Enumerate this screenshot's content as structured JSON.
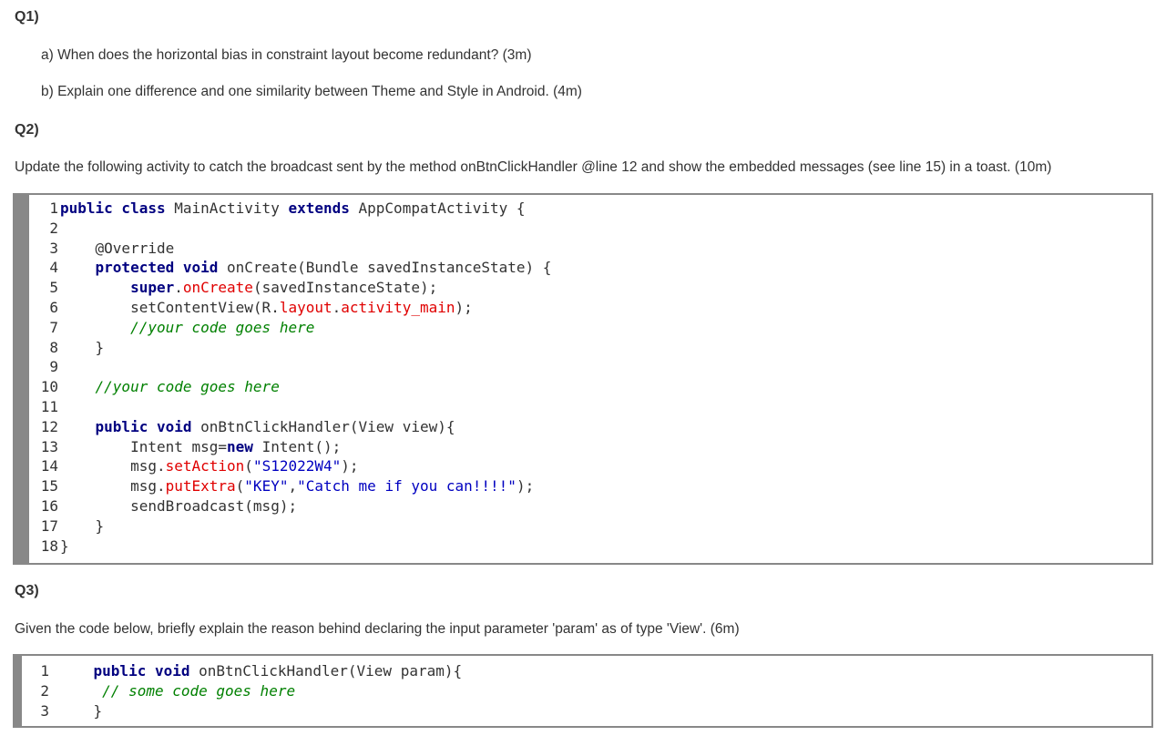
{
  "q1": {
    "heading": "Q1)",
    "a": "a) When does the horizontal bias in constraint layout become redundant? (3m)",
    "b": "b) Explain one difference and one similarity between Theme and Style in Android. (4m)"
  },
  "q2": {
    "heading": "Q2)",
    "prompt": "Update the following activity to catch the broadcast sent by the method onBtnClickHandler @line 12 and show the embedded messages (see line 15) in a toast. (10m)",
    "code": [
      {
        "n": "1",
        "indent": "",
        "tokens": [
          {
            "t": "public class",
            "c": "kw"
          },
          {
            "t": " MainActivity ",
            "c": "plain"
          },
          {
            "t": "extends",
            "c": "kw"
          },
          {
            "t": " AppCompatActivity {",
            "c": "plain"
          }
        ]
      },
      {
        "n": "2",
        "indent": "",
        "tokens": []
      },
      {
        "n": "3",
        "indent": "    ",
        "tokens": [
          {
            "t": "@Override",
            "c": "plain"
          }
        ]
      },
      {
        "n": "4",
        "indent": "    ",
        "tokens": [
          {
            "t": "protected void",
            "c": "kw"
          },
          {
            "t": " onCreate(Bundle savedInstanceState) {",
            "c": "plain"
          }
        ]
      },
      {
        "n": "5",
        "indent": "        ",
        "tokens": [
          {
            "t": "super",
            "c": "kw"
          },
          {
            "t": ".",
            "c": "plain"
          },
          {
            "t": "onCreate",
            "c": "fn"
          },
          {
            "t": "(savedInstanceState);",
            "c": "plain"
          }
        ]
      },
      {
        "n": "6",
        "indent": "        ",
        "tokens": [
          {
            "t": "setContentView(R.",
            "c": "plain"
          },
          {
            "t": "layout",
            "c": "fn"
          },
          {
            "t": ".",
            "c": "plain"
          },
          {
            "t": "activity_main",
            "c": "fn"
          },
          {
            "t": ");",
            "c": "plain"
          }
        ]
      },
      {
        "n": "7",
        "indent": "        ",
        "tokens": [
          {
            "t": "//your code goes here",
            "c": "cm"
          }
        ]
      },
      {
        "n": "8",
        "indent": "    ",
        "tokens": [
          {
            "t": "}",
            "c": "plain"
          }
        ]
      },
      {
        "n": "9",
        "indent": "",
        "tokens": []
      },
      {
        "n": "10",
        "indent": "    ",
        "tokens": [
          {
            "t": "//your code goes here",
            "c": "cm"
          }
        ]
      },
      {
        "n": "11",
        "indent": "",
        "tokens": []
      },
      {
        "n": "12",
        "indent": "    ",
        "tokens": [
          {
            "t": "public void",
            "c": "kw"
          },
          {
            "t": " onBtnClickHandler(View view){",
            "c": "plain"
          }
        ]
      },
      {
        "n": "13",
        "indent": "        ",
        "tokens": [
          {
            "t": "Intent msg=",
            "c": "plain"
          },
          {
            "t": "new",
            "c": "kw"
          },
          {
            "t": " Intent();",
            "c": "plain"
          }
        ]
      },
      {
        "n": "14",
        "indent": "        ",
        "tokens": [
          {
            "t": "msg.",
            "c": "plain"
          },
          {
            "t": "setAction",
            "c": "fn"
          },
          {
            "t": "(",
            "c": "plain"
          },
          {
            "t": "\"S12022W4\"",
            "c": "str"
          },
          {
            "t": ");",
            "c": "plain"
          }
        ]
      },
      {
        "n": "15",
        "indent": "        ",
        "tokens": [
          {
            "t": "msg.",
            "c": "plain"
          },
          {
            "t": "putExtra",
            "c": "fn"
          },
          {
            "t": "(",
            "c": "plain"
          },
          {
            "t": "\"KEY\"",
            "c": "str"
          },
          {
            "t": ",",
            "c": "plain"
          },
          {
            "t": "\"Catch me if you can!!!!\"",
            "c": "str"
          },
          {
            "t": ");",
            "c": "plain"
          }
        ]
      },
      {
        "n": "16",
        "indent": "        ",
        "tokens": [
          {
            "t": "sendBroadcast(msg);",
            "c": "plain"
          }
        ]
      },
      {
        "n": "17",
        "indent": "    ",
        "tokens": [
          {
            "t": "}",
            "c": "plain"
          }
        ]
      },
      {
        "n": "18",
        "indent": "",
        "tokens": [
          {
            "t": "}",
            "c": "plain"
          }
        ]
      }
    ]
  },
  "q3": {
    "heading": "Q3)",
    "prompt": "Given the code below, briefly explain the reason behind declaring the input parameter 'param' as of type 'View'.  (6m)",
    "code": [
      {
        "n": "1",
        "indent": "    ",
        "tokens": [
          {
            "t": "public void",
            "c": "kw"
          },
          {
            "t": " onBtnClickHandler(View param){",
            "c": "plain"
          }
        ]
      },
      {
        "n": "2",
        "indent": "    ",
        "tokens": [
          {
            "t": " // some code goes here",
            "c": "cm"
          }
        ]
      },
      {
        "n": "3",
        "indent": "    ",
        "tokens": [
          {
            "t": "}",
            "c": "plain"
          }
        ]
      }
    ]
  }
}
